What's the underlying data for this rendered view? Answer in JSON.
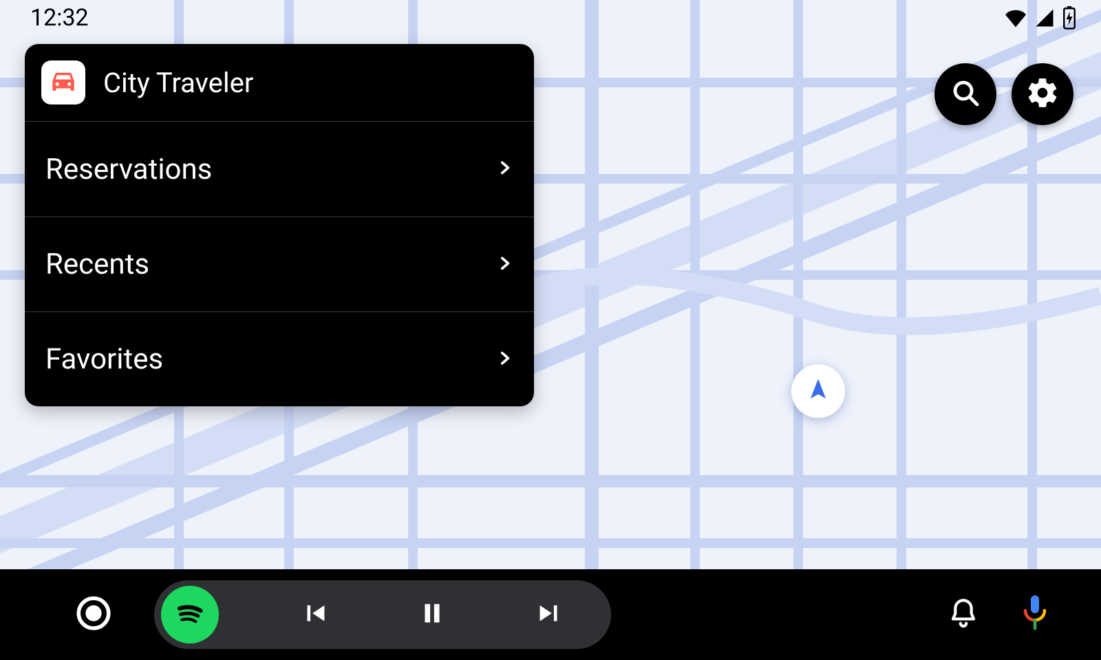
{
  "status": {
    "time": "12:32"
  },
  "panel": {
    "title": "City Traveler",
    "items": [
      {
        "label": "Reservations"
      },
      {
        "label": "Recents"
      },
      {
        "label": "Favorites"
      }
    ]
  },
  "icons": {
    "car": "car-icon",
    "chevron": "chevron-right-icon",
    "search": "search-icon",
    "gear": "gear-icon",
    "wifi": "wifi-icon",
    "signal": "cell-signal-icon",
    "battery": "battery-charging-icon",
    "launcher": "launcher-icon",
    "spotify": "spotify-icon",
    "prev": "skip-previous-icon",
    "pause": "pause-icon",
    "next": "skip-next-icon",
    "bell": "notifications-icon",
    "mic": "assistant-mic-icon",
    "nav_arrow": "navigation-arrow-icon"
  },
  "colors": {
    "accent": "#1ed760",
    "car_badge": "#ff5a4b",
    "nav_arrow": "#3a6be8",
    "mic_blue": "#4285F4",
    "mic_red": "#EA4335",
    "mic_yellow": "#FBBC05",
    "mic_green": "#34A853"
  }
}
